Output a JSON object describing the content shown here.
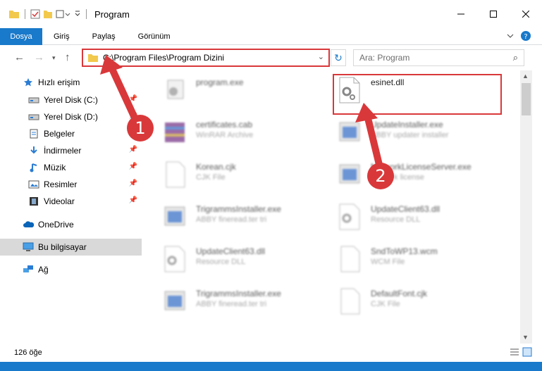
{
  "window": {
    "title": "Program"
  },
  "ribbon": {
    "tabs": [
      "Dosya",
      "Giriş",
      "Paylaş",
      "Görünüm"
    ]
  },
  "address": {
    "path": "C:\\Program Files\\Program Dizini"
  },
  "search": {
    "placeholder": "Ara: Program"
  },
  "sidebar": {
    "items": [
      {
        "label": "Hızlı erişim",
        "icon": "star-icon"
      },
      {
        "label": "Yerel Disk (C:)",
        "icon": "drive-icon",
        "pinned": true
      },
      {
        "label": "Yerel Disk (D:)",
        "icon": "drive-icon",
        "pinned": true
      },
      {
        "label": "Belgeler",
        "icon": "document-icon",
        "pinned": true
      },
      {
        "label": "İndirmeler",
        "icon": "download-icon",
        "pinned": true
      },
      {
        "label": "Müzik",
        "icon": "music-icon",
        "pinned": true
      },
      {
        "label": "Resimler",
        "icon": "pictures-icon",
        "pinned": true
      },
      {
        "label": "Videolar",
        "icon": "video-icon",
        "pinned": true
      },
      {
        "label": "OneDrive",
        "icon": "cloud-icon"
      },
      {
        "label": "Bu bilgisayar",
        "icon": "computer-icon",
        "selected": true
      },
      {
        "label": "Ağ",
        "icon": "network-icon"
      }
    ]
  },
  "files": [
    {
      "name": "program.exe",
      "type": ""
    },
    {
      "name": "esinet.dll",
      "type": ""
    },
    {
      "name": "certificates.cab",
      "type": "WinRAR Archive"
    },
    {
      "name": "UpdateInstaller.exe",
      "type": "ABBY updater installer"
    },
    {
      "name": "Korean.cjk",
      "type": "CJK File"
    },
    {
      "name": "NetworkLicenseServer.exe",
      "type": "network license"
    },
    {
      "name": "TrigrammsInstaller.exe",
      "type": "ABBY fineread.ter tri"
    },
    {
      "name": "UpdateClient63.dll",
      "type": "Resource DLL"
    },
    {
      "name": "UpdateClient63.dll",
      "type": "Resource DLL"
    },
    {
      "name": "SndToWP13.wcm",
      "type": "WCM File"
    },
    {
      "name": "TrigrammsInstaller.exe",
      "type": "ABBY fineread.ter tri"
    },
    {
      "name": "DefaultFont.cjk",
      "type": "CJK File"
    }
  ],
  "status": {
    "count": "126 öğe"
  },
  "callouts": [
    "1",
    "2"
  ],
  "colors": {
    "accent": "#1979ca",
    "highlight": "#d9383a"
  }
}
